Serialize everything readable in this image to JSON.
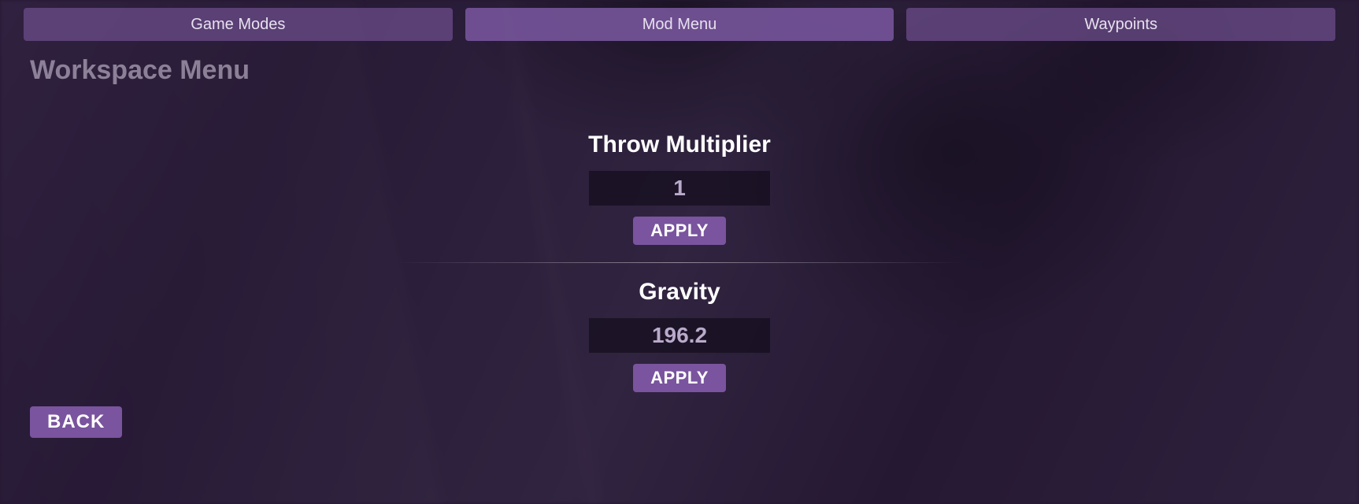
{
  "tabs": {
    "game_modes": "Game Modes",
    "mod_menu": "Mod Menu",
    "waypoints": "Waypoints"
  },
  "title": "Workspace Menu",
  "settings": {
    "throw_multiplier": {
      "label": "Throw Multiplier",
      "value": "1",
      "apply": "APPLY"
    },
    "gravity": {
      "label": "Gravity",
      "value": "196.2",
      "apply": "APPLY"
    }
  },
  "back": "BACK"
}
